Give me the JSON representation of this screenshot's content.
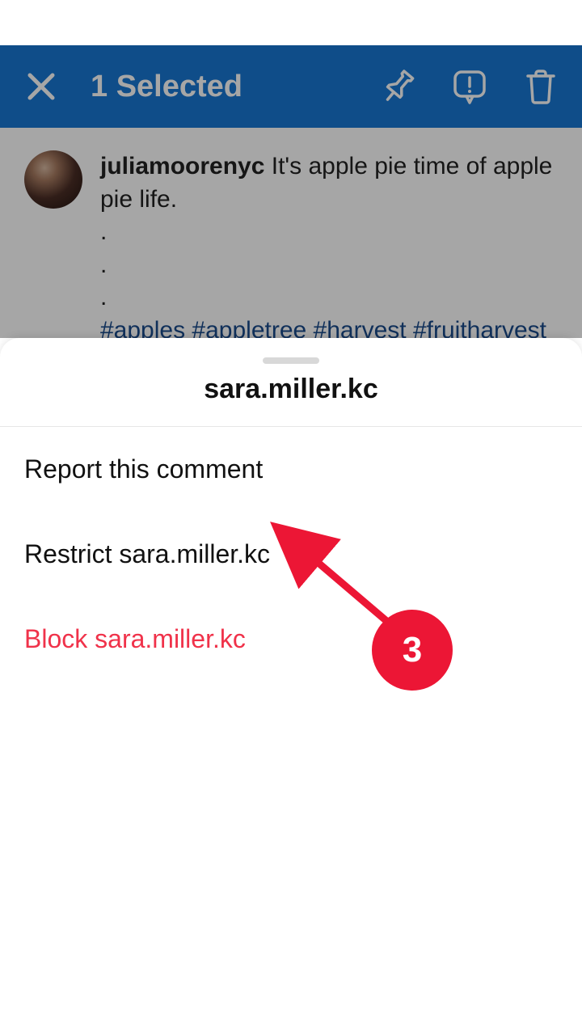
{
  "header": {
    "title": "1 Selected"
  },
  "post": {
    "username": "juliamoorenyc",
    "caption": "It's apple pie time of apple pie life.",
    "hashtags": "#apples #appletree #harvest #fruitharvest #gardentrees #summergarden"
  },
  "sheet": {
    "username": "sara.miller.kc",
    "items": {
      "report": "Report this comment",
      "restrict": "Restrict sara.miller.kc",
      "block": "Block sara.miller.kc"
    }
  },
  "annotation": {
    "number": "3"
  },
  "colors": {
    "headerBg": "#1877d3",
    "hashtag": "#1a4a8a",
    "danger": "#f0324a",
    "annotation": "#ec1635"
  }
}
